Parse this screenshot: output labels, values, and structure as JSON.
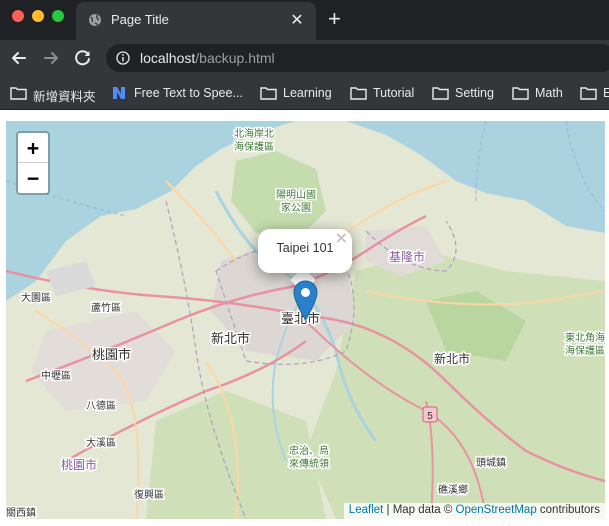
{
  "tab": {
    "title": "Page Title",
    "close": "✕"
  },
  "new_tab": "+",
  "address": {
    "host": "localhost",
    "path": "/backup.html"
  },
  "bookmarks": [
    {
      "label": "新增資料夾",
      "icon": "folder-icon"
    },
    {
      "label": "Free Text to Spee...",
      "icon": "n-logo-icon"
    },
    {
      "label": "Learning",
      "icon": "folder-icon"
    },
    {
      "label": "Tutorial",
      "icon": "folder-icon"
    },
    {
      "label": "Setting",
      "icon": "folder-icon"
    },
    {
      "label": "Math",
      "icon": "folder-icon"
    },
    {
      "label": "E",
      "icon": "folder-icon"
    }
  ],
  "map": {
    "zoom_in": "+",
    "zoom_out": "−",
    "popup_text": "Taipei 101",
    "popup_close": "×",
    "attribution": {
      "leaflet": "Leaflet",
      "sep": " | Map data © ",
      "osm": "OpenStreetMap",
      "suffix": " contributors"
    },
    "labels": {
      "taipei_city": "臺北市",
      "new_taipei_center": "新北市",
      "new_taipei_east": "新北市",
      "taoyuan": "桃園市",
      "taoyuan_sw": "桃園市",
      "keelung": "基隆市",
      "yangmingshan_1": "陽明山國",
      "yangmingshan_2": "家公園",
      "north_coast_1": "北海岸北",
      "north_coast_2": "海保護區",
      "ne_coast_1": "東北角海",
      "ne_coast_2": "海保護區",
      "dayuan": "大園區",
      "luzhu": "蘆竹區",
      "zhongli": "中壢區",
      "bade": "八德區",
      "daxi": "大溪區",
      "fuxing": "復興區",
      "guanxi": "關西鎮",
      "toucheng": "頭城鎮",
      "jiaoxi": "礁溪鄉",
      "wulai_1": "忠治、烏",
      "wulai_2": "來傳統領",
      "route": "5"
    }
  }
}
